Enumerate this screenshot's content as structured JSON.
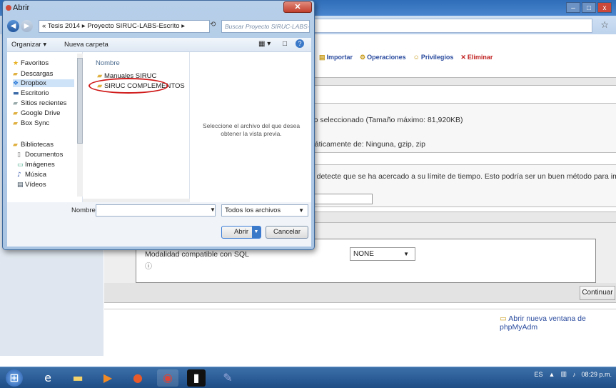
{
  "dialog": {
    "title": "Abrir",
    "breadcrumb": "« Tesis 2014 ▸ Proyecto SIRUC-LABS-Escrito ▸",
    "search_placeholder": "Buscar Proyecto SIRUC-LABS-E...",
    "organize": "Organizar ▾",
    "new_folder": "Nueva carpeta",
    "nav_items": [
      {
        "label": "Favoritos",
        "icon": "star-icon"
      },
      {
        "label": "Descargas",
        "icon": "folder-icon"
      },
      {
        "label": "Dropbox",
        "icon": "dropbox-icon"
      },
      {
        "label": "Escritorio",
        "icon": "desktop-icon"
      },
      {
        "label": "Sitios recientes",
        "icon": "folder-icon"
      },
      {
        "label": "Google Drive",
        "icon": "folder-icon"
      },
      {
        "label": "Box Sync",
        "icon": "folder-icon"
      },
      {
        "label": "Bibliotecas",
        "icon": "library-icon"
      },
      {
        "label": "Documentos",
        "icon": "document-icon"
      },
      {
        "label": "Imágenes",
        "icon": "image-icon"
      },
      {
        "label": "Música",
        "icon": "music-icon"
      },
      {
        "label": "Vídeos",
        "icon": "video-icon"
      }
    ],
    "column_header": "Nombre",
    "files": [
      "Manuales SIRUC",
      "SIRUC COMPLEMENTOS"
    ],
    "preview_text": "Seleccione el archivo del que desea obtener la vista previa.",
    "filename_label": "Nombre:",
    "filename_value": "",
    "filter": "Todos los archivos",
    "open_button": "Abrir",
    "cancel_button": "Cancelar"
  },
  "page": {
    "tabs": [
      "Importar",
      "Operaciones",
      "Privilegios",
      "Eliminar"
    ],
    "line1": "ivo seleccionado  (Tamaño máximo: 81,920KB)",
    "line2": "máticamente de: Ninguna, gzip, zip",
    "line3": "pt detecte que se ha acercado a su límite de tiempo. Esto podría ser un buen método para importar",
    "sql_mode_label": "Modalidad compatible con SQL",
    "sql_mode_value": "NONE",
    "continue_button": "Continuar",
    "new_window_link": "Abrir nueva ventana de phpMyAdm"
  },
  "taskbar": {
    "lang": "ES",
    "time": "08:29 p.m."
  }
}
